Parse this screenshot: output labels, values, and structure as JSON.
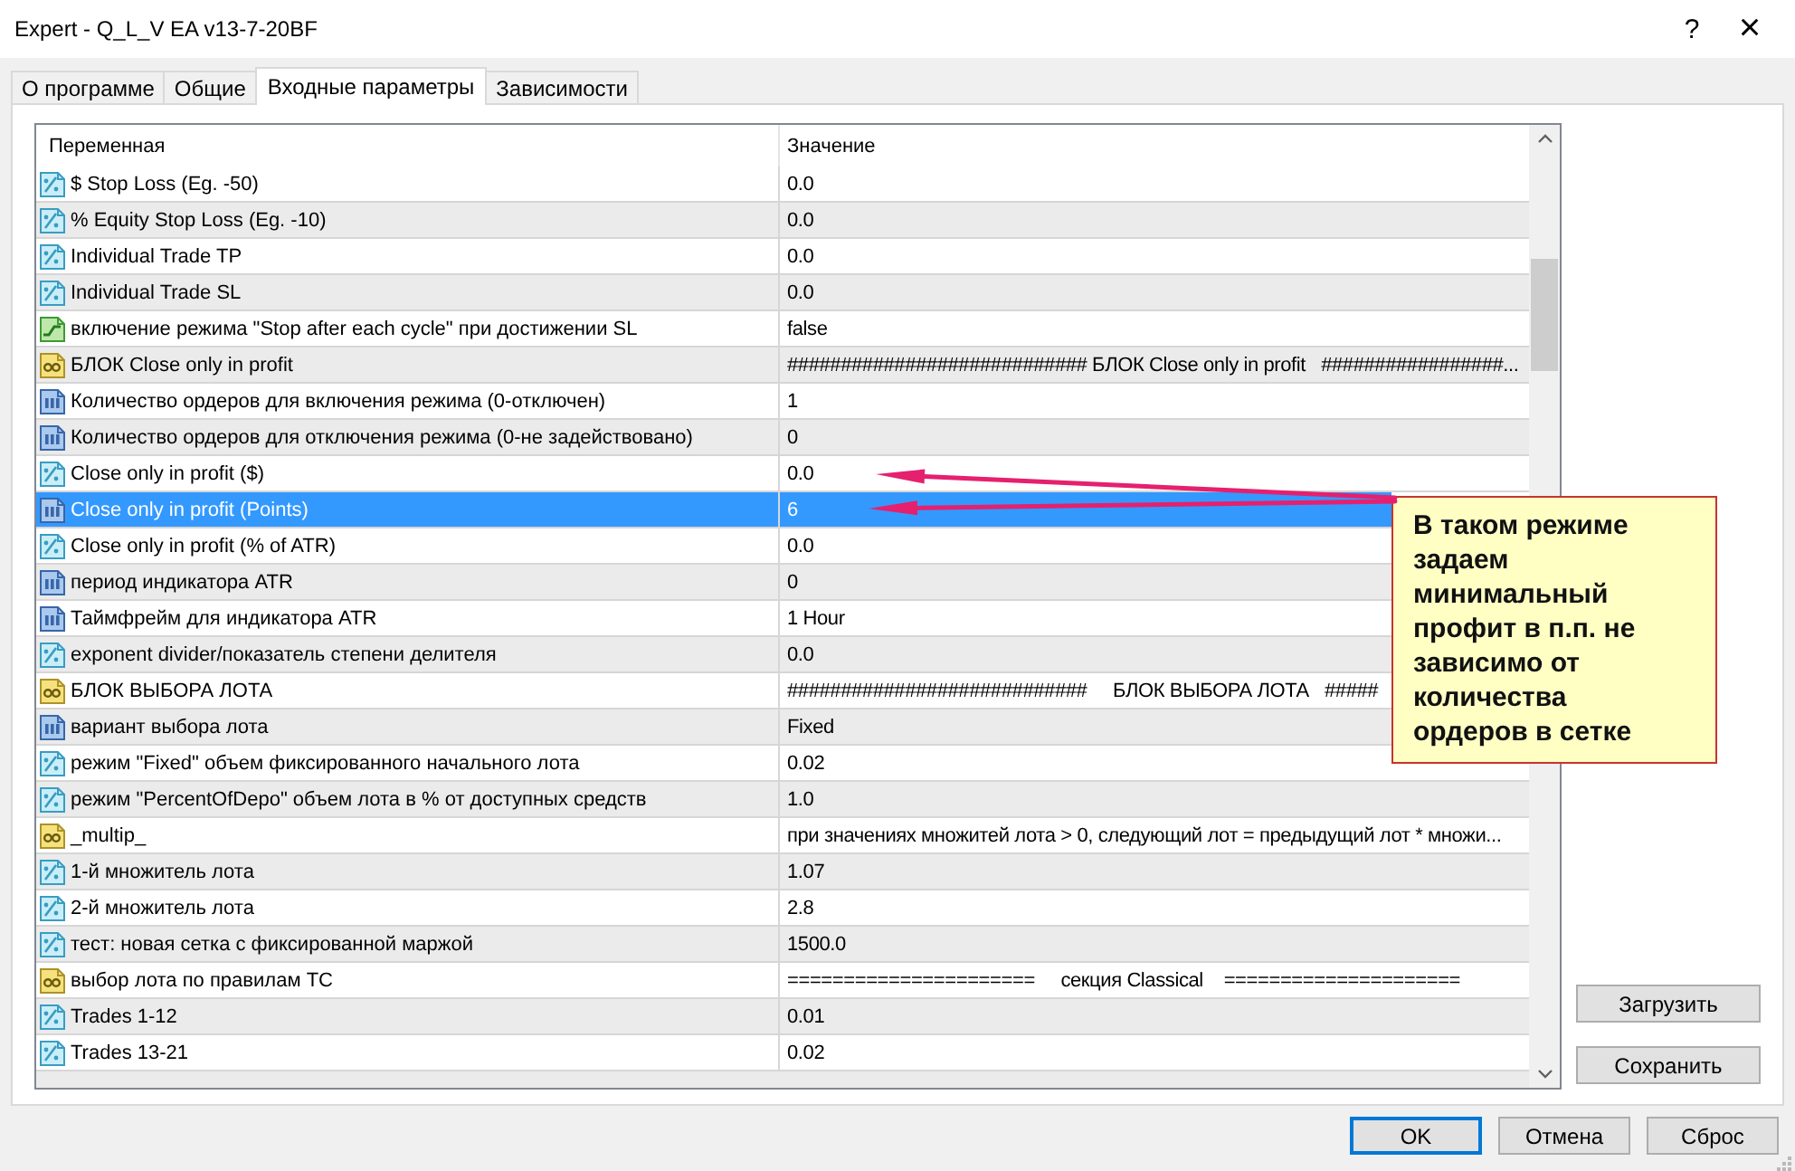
{
  "window": {
    "title": "Expert - Q_L_V EA v13-7-20BF",
    "help_button": "?",
    "close_button": "×"
  },
  "tabs": [
    {
      "label": "О программе",
      "selected": false
    },
    {
      "label": "Общие",
      "selected": false
    },
    {
      "label": "Входные параметры",
      "selected": true
    },
    {
      "label": "Зависимости",
      "selected": false
    }
  ],
  "table": {
    "columns": [
      "Переменная",
      "Значение"
    ],
    "rows": [
      {
        "kind": "double",
        "name": "$ Stop Loss (Eg. -50)",
        "value": "0.0",
        "selected": false
      },
      {
        "kind": "double",
        "name": "% Equity Stop Loss (Eg. -10)",
        "value": "0.0",
        "selected": false
      },
      {
        "kind": "double",
        "name": "Individual Trade TP",
        "value": "0.0",
        "selected": false
      },
      {
        "kind": "double",
        "name": "Individual Trade SL",
        "value": "0.0",
        "selected": false
      },
      {
        "kind": "bool",
        "name": "включение режима \"Stop after each cycle\" при достижении SL",
        "value": "false",
        "selected": false
      },
      {
        "kind": "string",
        "name": "БЛОК Close only in profit",
        "value": "############################ БЛОК Close only in profit   #################...",
        "selected": false
      },
      {
        "kind": "int",
        "name": "Количество ордеров для включения режима (0-отключен)",
        "value": "1",
        "selected": false
      },
      {
        "kind": "int",
        "name": "Количество ордеров для отключения режима (0-не задействовано)",
        "value": "0",
        "selected": false
      },
      {
        "kind": "double",
        "name": "Close only in profit ($)",
        "value": "0.0",
        "selected": false
      },
      {
        "kind": "int",
        "name": "Close only in profit (Points)",
        "value": "6",
        "selected": true
      },
      {
        "kind": "double",
        "name": "Close only in profit (% of ATR)",
        "value": "0.0",
        "selected": false
      },
      {
        "kind": "int",
        "name": "период индикатора ATR",
        "value": "0",
        "selected": false
      },
      {
        "kind": "int",
        "name": "Таймфрейм для индикатора ATR",
        "value": "1 Hour",
        "selected": false
      },
      {
        "kind": "double",
        "name": "exponent divider/показатель степени делителя",
        "value": "0.0",
        "selected": false
      },
      {
        "kind": "string",
        "name": "БЛОК ВЫБОРА ЛОТА",
        "value": "############################     БЛОК ВЫБОРА ЛОТА   #####",
        "selected": false
      },
      {
        "kind": "int",
        "name": "вариант выбора лота",
        "value": "Fixed",
        "selected": false
      },
      {
        "kind": "double",
        "name": "режим \"Fixed\" объем фиксированного начального лота",
        "value": "0.02",
        "selected": false
      },
      {
        "kind": "double",
        "name": "режим \"PercentOfDepo\" объем лота в % от доступных средств",
        "value": "1.0",
        "selected": false
      },
      {
        "kind": "string",
        "name": "_multip_",
        "value": "при значениях множитей лота > 0, следующий лот = предыдущий лот * множи...",
        "selected": false
      },
      {
        "kind": "double",
        "name": "1-й множитель лота",
        "value": "1.07",
        "selected": false
      },
      {
        "kind": "double",
        "name": "2-й множитель лота",
        "value": "2.8",
        "selected": false
      },
      {
        "kind": "double",
        "name": "тест: новая сетка с фиксированной маржой",
        "value": "1500.0",
        "selected": false
      },
      {
        "kind": "string",
        "name": "выбор лота по правилам ТС",
        "value": "======================     секция Classical    =====================",
        "selected": false
      },
      {
        "kind": "double",
        "name": "Trades 1-12",
        "value": "0.01",
        "selected": false
      },
      {
        "kind": "double",
        "name": "Trades 13-21",
        "value": "0.02",
        "selected": false
      }
    ]
  },
  "callout": {
    "text": "В таком режиме\nзадаем\nминимальный\nпрофит в п.п. не\nзависимо от\nколичества\nордеров в сетке"
  },
  "side_buttons": [
    {
      "label": "Загрузить"
    },
    {
      "label": "Сохранить"
    }
  ],
  "buttons": [
    {
      "label": "OK",
      "default": true
    },
    {
      "label": "Отмена",
      "default": false
    },
    {
      "label": "Сброс",
      "default": false
    }
  ]
}
